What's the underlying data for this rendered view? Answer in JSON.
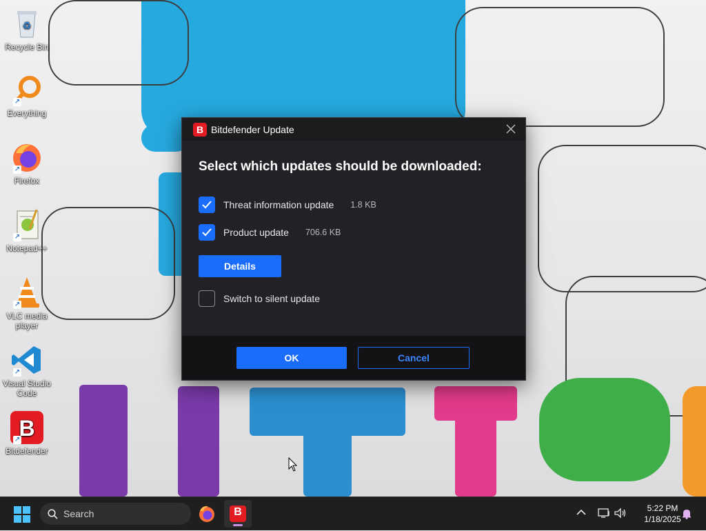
{
  "desktop": {
    "icons": [
      {
        "label": "Recycle Bin",
        "icon": "recycle-bin-icon"
      },
      {
        "label": "Everything",
        "icon": "everything-search-icon"
      },
      {
        "label": "Firefox",
        "icon": "firefox-icon"
      },
      {
        "label": "Notepad++",
        "icon": "notepad-plus-plus-icon"
      },
      {
        "label": "VLC media player",
        "icon": "vlc-icon"
      },
      {
        "label": "Visual Studio Code",
        "icon": "vscode-icon"
      },
      {
        "label": "Bitdefender",
        "icon": "bitdefender-icon"
      }
    ]
  },
  "dialog": {
    "title": "Bitdefender Update",
    "logo_letter": "B",
    "heading": "Select which updates should be downloaded:",
    "options": [
      {
        "label": "Threat information update",
        "size": "1.8 KB",
        "checked": true
      },
      {
        "label": "Product update",
        "size": "706.6 KB",
        "checked": true
      }
    ],
    "details_label": "Details",
    "silent": {
      "label": "Switch to silent update",
      "checked": false
    },
    "ok_label": "OK",
    "cancel_label": "Cancel"
  },
  "taskbar": {
    "search_placeholder": "Search",
    "time": "5:22 PM",
    "date": "1/18/2025",
    "bitdefender_letter": "B"
  },
  "colors": {
    "accent": "#1a6dfa",
    "brand_red": "#e31b23",
    "dialog_bg": "#222226"
  }
}
